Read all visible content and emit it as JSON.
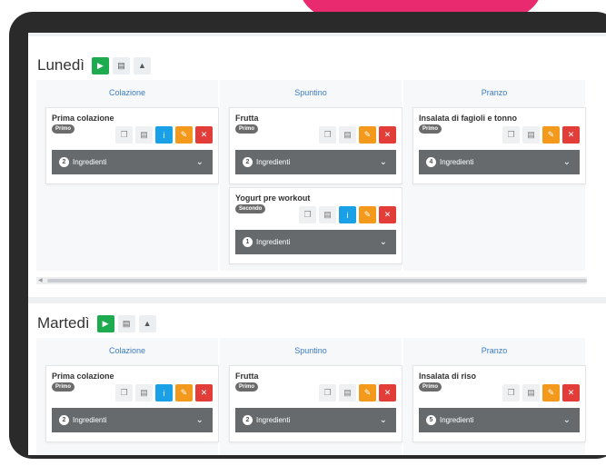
{
  "colors": {
    "add": "#1eaa4f",
    "info": "#1aa0e6",
    "edit": "#f39a1c",
    "delete": "#e23d38",
    "header_text": "#3b7bbf",
    "ingredients_bar": "#666a6d",
    "accent_blob": "#ea2a6f"
  },
  "days": [
    {
      "name": "Lunedì",
      "columns": [
        "Colazione",
        "Spuntino",
        "Pranzo"
      ],
      "cards": [
        {
          "title": "Prima colazione",
          "badge": "Primo",
          "ingredients_count": "2",
          "ingredients_label": "Ingredienti"
        },
        {
          "title": "Frutta",
          "badge": "Primo",
          "ingredients_count": "2",
          "ingredients_label": "Ingredienti"
        },
        {
          "title": "Insalata di fagioli e tonno",
          "badge": "Primo",
          "ingredients_count": "4",
          "ingredients_label": "Ingredienti"
        },
        {
          "title": "Yogurt pre workout",
          "badge": "Secondo",
          "ingredients_count": "1",
          "ingredients_label": "Ingredienti"
        }
      ]
    },
    {
      "name": "Martedì",
      "columns": [
        "Colazione",
        "Spuntino",
        "Pranzo"
      ],
      "cards": [
        {
          "title": "Prima colazione",
          "badge": "Primo",
          "ingredients_count": "2",
          "ingredients_label": "Ingredienti"
        },
        {
          "title": "Frutta",
          "badge": "Primo",
          "ingredients_count": "2",
          "ingredients_label": "Ingredienti"
        },
        {
          "title": "Insalata di riso",
          "badge": "Primo",
          "ingredients_count": "5",
          "ingredients_label": "Ingredienti"
        }
      ]
    }
  ]
}
